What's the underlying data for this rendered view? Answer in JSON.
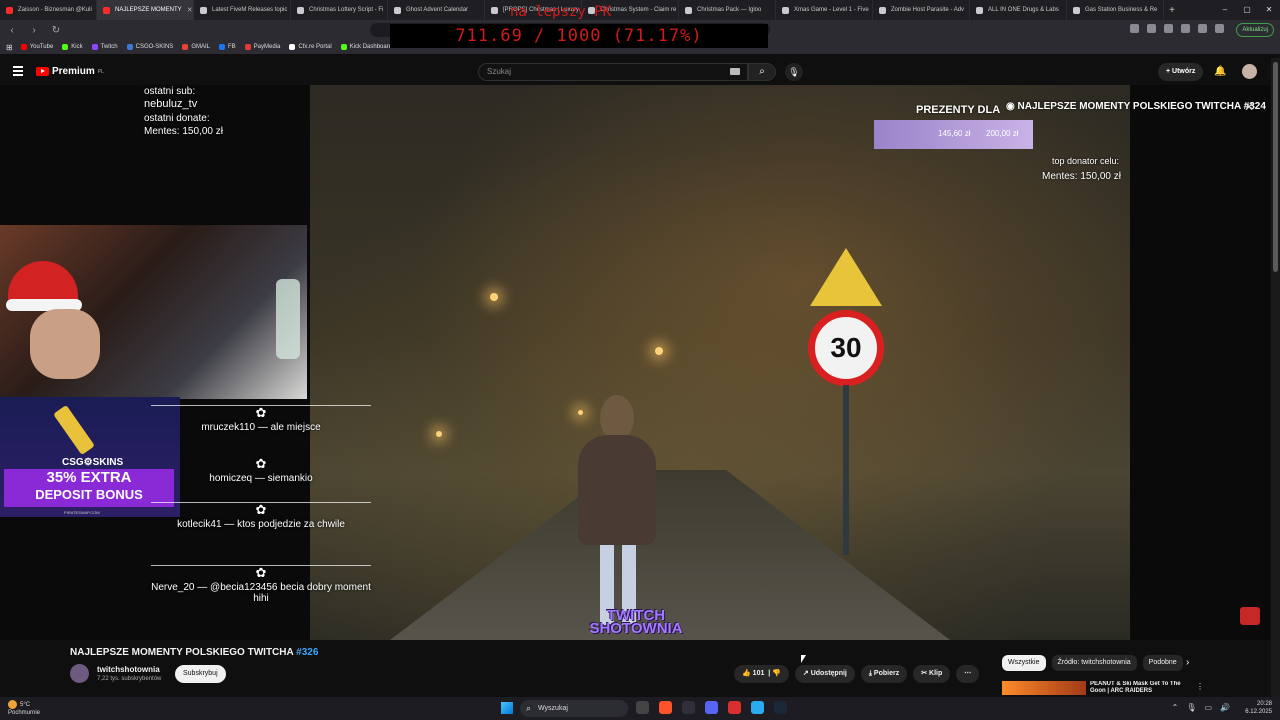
{
  "browser": {
    "tabs": [
      {
        "label": "Zaisson - Biznesman @Kuli",
        "icon": "red"
      },
      {
        "label": "NAJLEPSZE MOMENTY",
        "icon": "red",
        "active": true
      },
      {
        "label": "Latest FiveM Releases topic",
        "icon": "grey"
      },
      {
        "label": "Christmas Lottery Script - Fi",
        "icon": "grey"
      },
      {
        "label": "Ghost Advent Calendar",
        "icon": "grey"
      },
      {
        "label": "[PROPS] Christmas | Luxury",
        "icon": "grey"
      },
      {
        "label": "Christmas System - Claim re",
        "icon": "grey"
      },
      {
        "label": "Christmas Pack — Igloo",
        "icon": "grey"
      },
      {
        "label": "Xmas Game - Level 1 - Five",
        "icon": "grey"
      },
      {
        "label": "Zombie Host Parasite - Adv",
        "icon": "grey"
      },
      {
        "label": "ALL IN ONE Drugs & Labs",
        "icon": "grey"
      },
      {
        "label": "Gas Station Business & Re",
        "icon": "grey"
      }
    ],
    "new_tab": "+",
    "window_controls": [
      "–",
      "▢",
      "✕"
    ],
    "update_button": "Aktualizuj",
    "bookmarks": [
      {
        "label": "YouTube",
        "color": "#ff0000"
      },
      {
        "label": "Kick",
        "color": "#53fc18"
      },
      {
        "label": "Twitch",
        "color": "#9146ff"
      },
      {
        "label": "CSGO-SKINS",
        "color": "#3a7bd5"
      },
      {
        "label": "GMAIL",
        "color": "#ea4335"
      },
      {
        "label": "FB",
        "color": "#1877f2"
      },
      {
        "label": "PayMedia",
        "color": "#e53935"
      },
      {
        "label": "Cfx.re Portal",
        "color": "#ffffff"
      },
      {
        "label": "Kick Dashboard",
        "color": "#53fc18"
      }
    ]
  },
  "stream_goal": {
    "title": "na lepszy PK",
    "progress": "711.69 / 1000 (71.17%)"
  },
  "youtube": {
    "logo": "Premium",
    "logo_region": "PL",
    "search_placeholder": "Szukaj",
    "create_label": "Utwórz"
  },
  "overlay": {
    "last_sub_label": "ostatni sub:",
    "last_sub": "nebuluz_tv",
    "last_donate_label": "ostatni donate:",
    "last_donate": "Mentes: 150,00 zł",
    "gifts_title": "PREZENTY DLA",
    "donation_current": "145,60 zł",
    "donation_goal": "200,00 zł",
    "top_donator_label": "top donator celu:",
    "top_donator": "Mentes: 150,00 zł",
    "video_title_overlay": "NAJLEPSZE MOMENTY POLSKIEGO TWITCHA #324",
    "speed_sign": "30",
    "watermark_line1": "TWITCH",
    "watermark_line2": "SHOTOWNIA"
  },
  "ad": {
    "brand": "CSG⚙SKINS",
    "line1": "35% EXTRA",
    "line2": "DEPOSIT BONUS",
    "url": "PIRATESWAP.COM"
  },
  "chat": [
    {
      "user": "mruczek110",
      "text": "ale miejsce"
    },
    {
      "user": "homiczeq",
      "text": "siemankio"
    },
    {
      "user": "kotlecik41",
      "text": "ktos podjedzie za chwile"
    },
    {
      "user": "Nerve_20",
      "text": "@becia123456 becia dobry moment hihi"
    }
  ],
  "video": {
    "title_main": "NAJLEPSZE MOMENTY POLSKIEGO TWITCHA",
    "title_hash": "#326",
    "channel": "twitchshotownia",
    "subscribers": "7,22 tys. subskrybentów",
    "subscribe_label": "Subskrybuj",
    "likes": "101",
    "share_label": "Udostępnij",
    "download_label": "Pobierz",
    "clip_label": "Klip",
    "more_label": "⋯"
  },
  "recommendations": {
    "chips": [
      "Wszystkie",
      "Źródło: twitchshotownia",
      "Podobne"
    ],
    "first_title": "PEANUT & Ski Mask Get To The Goon | ARC RAIDERS"
  },
  "taskbar": {
    "weather_temp": "5°C",
    "weather_text": "Pochmurnie",
    "search_label": "Wyszukaj",
    "time": "20:28",
    "date": "6.12.2025"
  }
}
